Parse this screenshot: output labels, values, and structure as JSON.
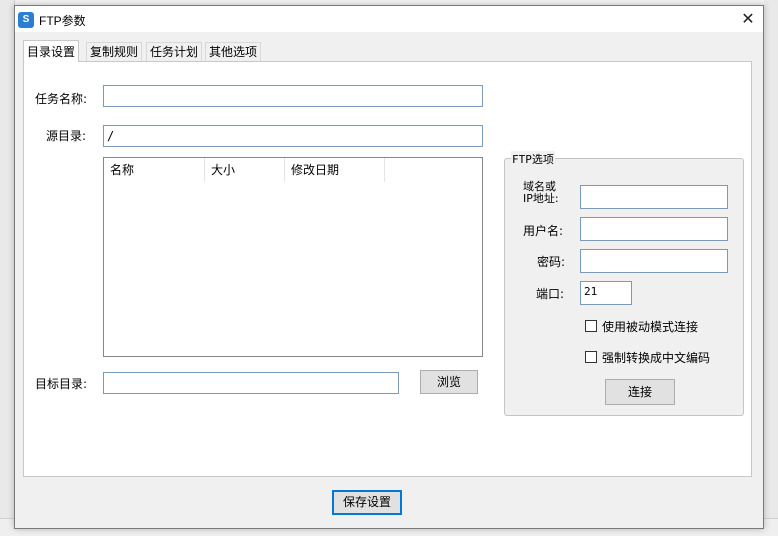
{
  "dialog": {
    "title": "FTP参数",
    "app_icon_glyph": "S",
    "close_glyph": "✕"
  },
  "tabs": [
    {
      "label": "目录设置",
      "active": true
    },
    {
      "label": "复制规则",
      "active": false
    },
    {
      "label": "任务计划",
      "active": false
    },
    {
      "label": "其他选项",
      "active": false
    }
  ],
  "form": {
    "task_name_label": "任务名称:",
    "task_name_value": "",
    "source_dir_label": "源目录:",
    "source_dir_value": "/",
    "columns": [
      "名称",
      "大小",
      "修改日期"
    ],
    "target_dir_label": "目标目录:",
    "target_dir_value": "",
    "browse_label": "浏览"
  },
  "ftp": {
    "group_title": "FTP选项",
    "host_label_line1": "域名或",
    "host_label_line2": "IP地址:",
    "host_value": "",
    "user_label": "用户名:",
    "user_value": "",
    "password_label": "密码:",
    "password_value": "",
    "port_label": "端口:",
    "port_value": "21",
    "passive_label": "使用被动模式连接",
    "passive_checked": false,
    "chinese_label": "强制转换成中文编码",
    "chinese_checked": false,
    "connect_label": "连接"
  },
  "footer": {
    "save_label": "保存设置"
  },
  "colors": {
    "input_border": "#7a9ab8",
    "default_button_border": "#0078d7",
    "icon_blue": "#2a7fd4"
  }
}
